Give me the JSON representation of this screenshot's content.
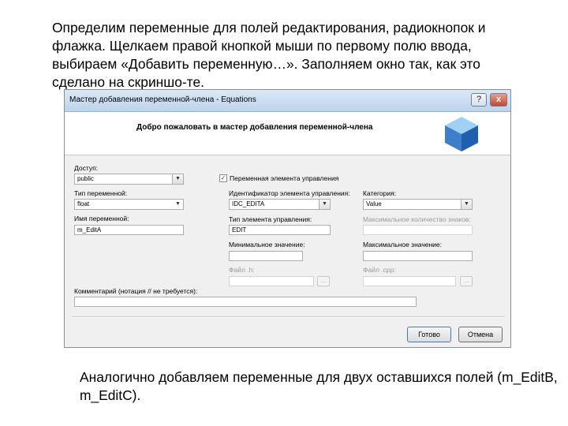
{
  "intro_text": "Определим переменные для полей редактирования, радиокнопок и флажка. Щелкаем правой кнопкой мыши по первому полю ввода, выбираем «Добавить переменную…». Заполняем окно так, как это сделано на скриншо-те.",
  "outro_text": "Аналогично добавляем переменные для двух оставшихся полей (m_EditB, m_EditC).",
  "dialog": {
    "title": "Мастер добавления переменной-члена - Equations",
    "help_glyph": "?",
    "close_glyph": "x",
    "welcome": "Добро пожаловать в мастер добавления переменной-члена",
    "access_label": "Доступ:",
    "access_value": "public",
    "control_var_label": "Переменная элемента управления",
    "control_var_checked": true,
    "check_glyph": "✓",
    "var_type_label": "Тип переменной:",
    "var_type_value": "float",
    "control_id_label": "Идентификатор элемента управления:",
    "control_id_value": "IDC_EDITA",
    "category_label": "Категория:",
    "category_value": "Value",
    "var_name_label": "Имя переменной:",
    "var_name_value": "m_EditA",
    "control_type_label": "Тип элемента управления:",
    "control_type_value": "EDIT",
    "max_chars_label": "Максимальное количество знаков:",
    "min_value_label": "Минимальное значение:",
    "max_value_label": "Максимальное значение:",
    "h_file_label": "Файл .h:",
    "cpp_file_label": "Файл .cpp:",
    "browse_glyph": "...",
    "comment_label": "Комментарий (нотация // не требуется):",
    "finish_label": "Готово",
    "cancel_label": "Отмена",
    "dropdown_glyph": "▼"
  },
  "colors": {
    "titlebar": "#bcd3ec",
    "dialog_bg": "#f0f0f0",
    "disabled_text": "#9a9a9a",
    "cube": "#4a90d9"
  },
  "icons": {
    "wizard": "blue-cube-icon",
    "dropdown": "chevron-down-icon",
    "help": "help-icon",
    "close": "close-icon"
  }
}
